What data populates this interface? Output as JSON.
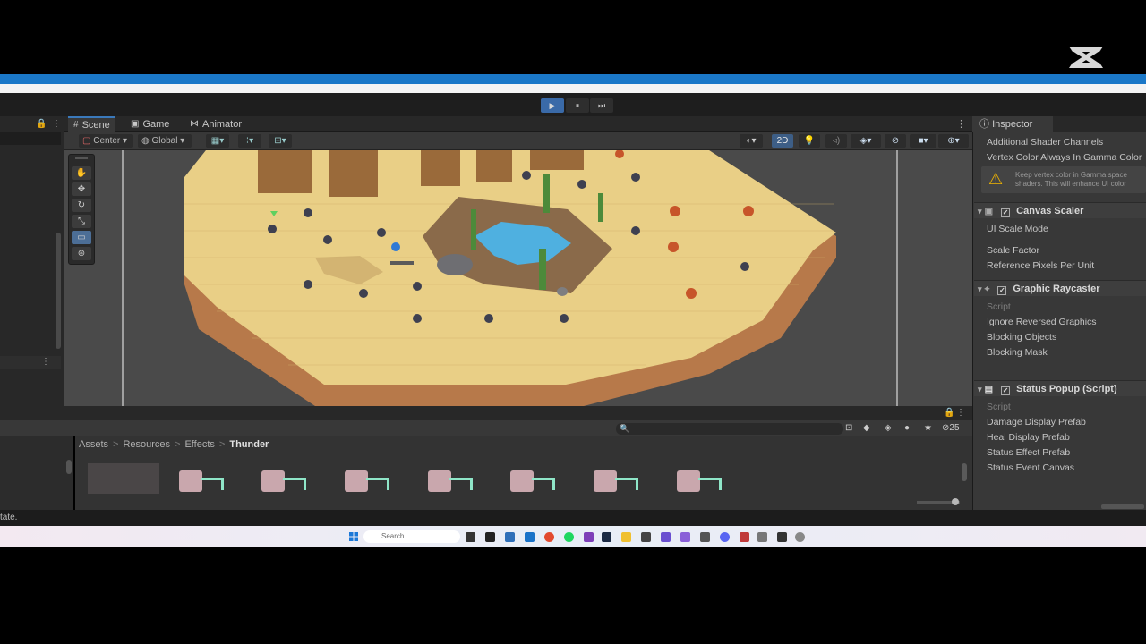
{
  "window": {
    "play_controls": {
      "play": "▶",
      "pause": "⏸",
      "step": "⏭"
    }
  },
  "tabs": [
    {
      "label": "Scene",
      "icon": "grid-icon"
    },
    {
      "label": "Game",
      "icon": "gamepad-icon"
    },
    {
      "label": "Animator",
      "icon": "animator-icon"
    }
  ],
  "scene_toolbar": {
    "pivot_label": "Center",
    "space_label": "Global",
    "mode_2d_label": "2D"
  },
  "inspector": {
    "tab_label": "Inspector",
    "rows_top": [
      "Additional Shader Channels",
      "Vertex Color Always In Gamma Color"
    ],
    "warning": "Keep vertex color in Gamma space shaders. This will enhance UI color",
    "components": [
      {
        "title": "Canvas Scaler",
        "fields": [
          "UI Scale Mode",
          "Scale Factor",
          "Reference Pixels Per Unit"
        ]
      },
      {
        "title": "Graphic Raycaster",
        "fields": [
          "Script",
          "Ignore Reversed Graphics",
          "Blocking Objects",
          "Blocking Mask"
        ]
      },
      {
        "title": "Status Popup (Script)",
        "fields": [
          "Script",
          "Damage Display Prefab",
          "Heal Display Prefab",
          "Status Effect Prefab",
          "Status Event Canvas"
        ]
      }
    ]
  },
  "project": {
    "breadcrumb": [
      "Assets",
      "Resources",
      "Effects",
      "Thunder"
    ],
    "hidden_count": "25",
    "asset_count_shown": 7
  },
  "status_bar": {
    "text": "tate."
  },
  "taskbar": {
    "search_placeholder": "Search"
  },
  "colors": {
    "accent": "#1b78c8",
    "play_active": "#3a6aa8",
    "asset_pink": "#c9a7ad",
    "asset_teal": "#8fe6c8",
    "sand": "#e8cf86"
  }
}
